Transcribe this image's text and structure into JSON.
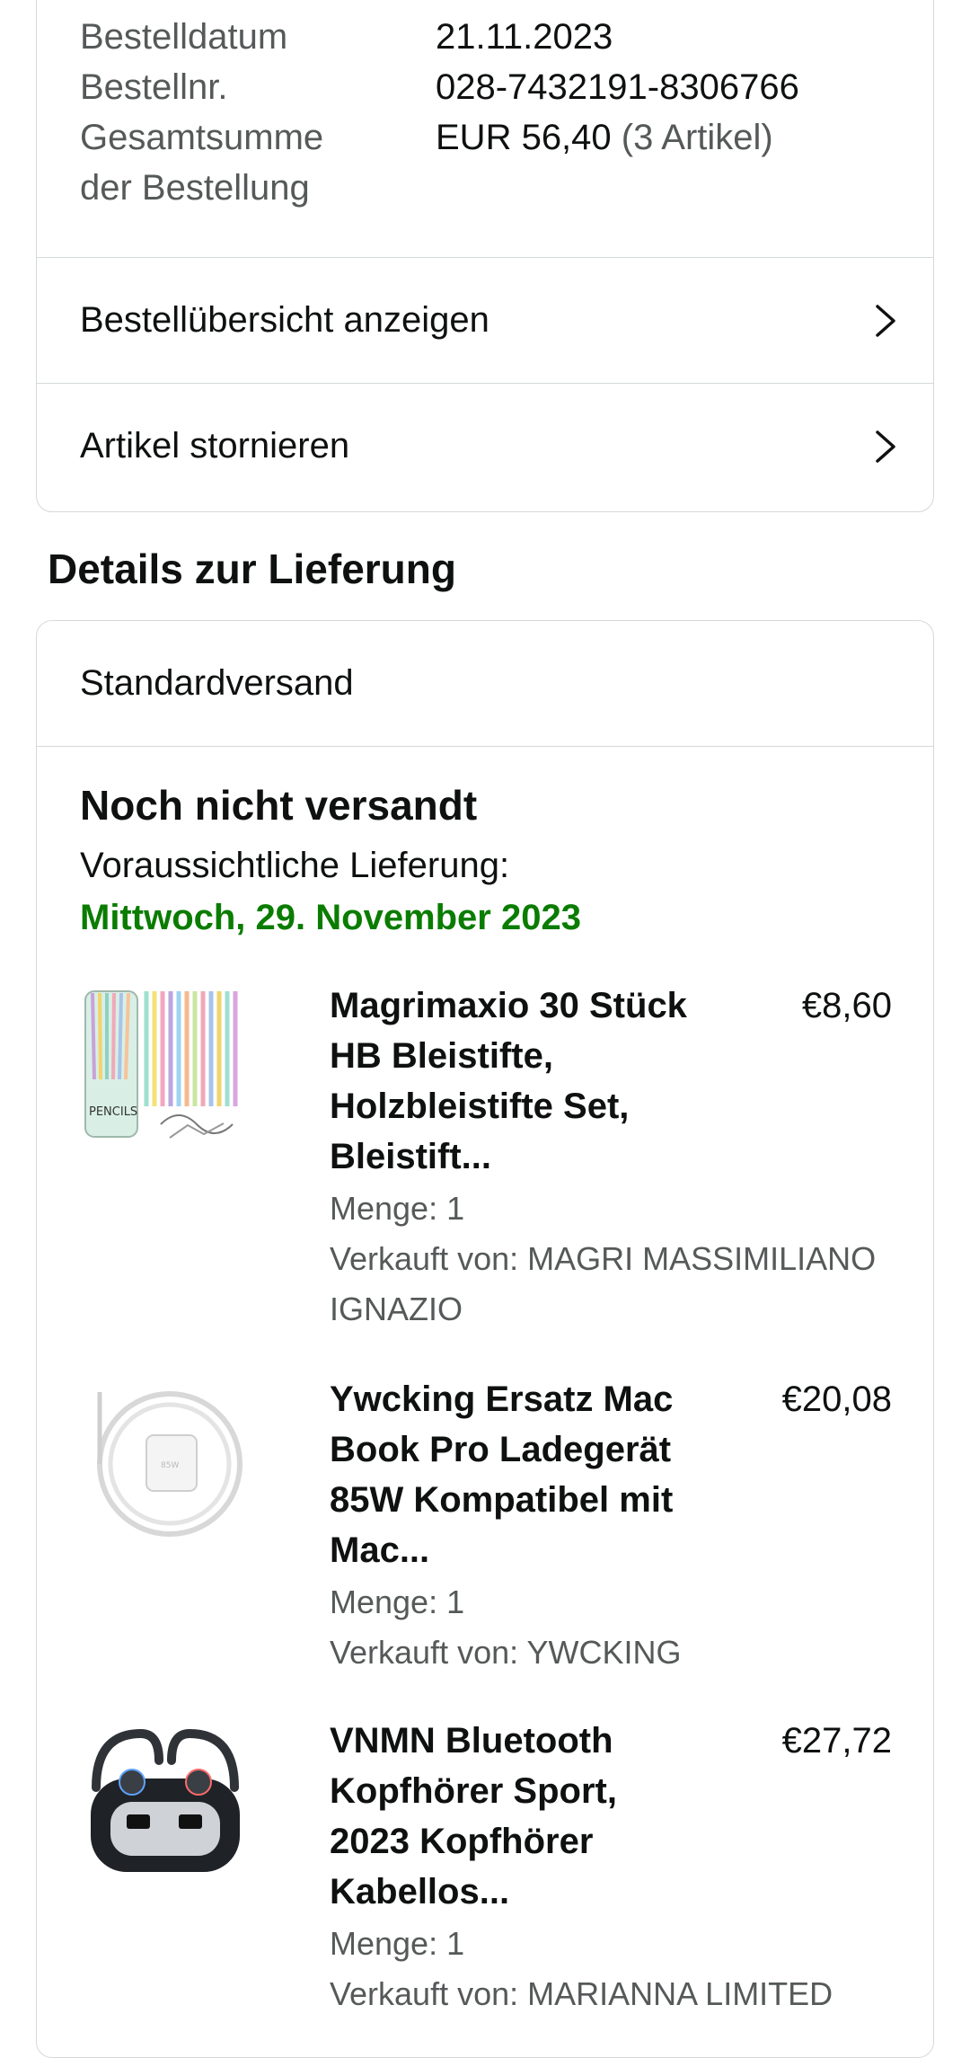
{
  "order": {
    "date_label": "Bestelldatum",
    "date_value": "21.11.2023",
    "number_label": "Bestellnr.",
    "number_value": "028-7432191-8306766",
    "total_label_1": "Gesamtsumme",
    "total_label_2": "der Bestellung",
    "total_value": "EUR 56,40",
    "total_count": "(3 Artikel)",
    "link_summary": "Bestellübersicht anzeigen",
    "link_cancel": "Artikel stornieren"
  },
  "delivery": {
    "section_title": "Details zur Lieferung",
    "method": "Standardversand",
    "status": "Noch nicht versandt",
    "eta_label": "Voraussichtliche Lieferung:",
    "eta_date": "Mittwoch, 29. November 2023",
    "eta_color": "#0a7c00"
  },
  "items": [
    {
      "title": "Magrimaxio 30 Stück HB Bleistifte, Holzbleistifte Set, Bleistift...",
      "price": "€8,60",
      "quantity": "Menge: 1",
      "seller": "Verkauft von: MAGRI MASSIMILIANO IGNAZIO",
      "icon": "pencils-product-image"
    },
    {
      "title": "Ywcking Ersatz Mac Book Pro Ladegerät 85W Kompatibel mit Mac...",
      "price": "€20,08",
      "quantity": "Menge: 1",
      "seller": "Verkauft von: YWCKING",
      "icon": "charger-product-image"
    },
    {
      "title": "VNMN Bluetooth Kopfhörer Sport, 2023 Kopfhörer Kabellos...",
      "price": "€27,72",
      "quantity": "Menge: 1",
      "seller": "Verkauft von: MARIANNA LIMITED",
      "icon": "earbuds-product-image"
    }
  ]
}
